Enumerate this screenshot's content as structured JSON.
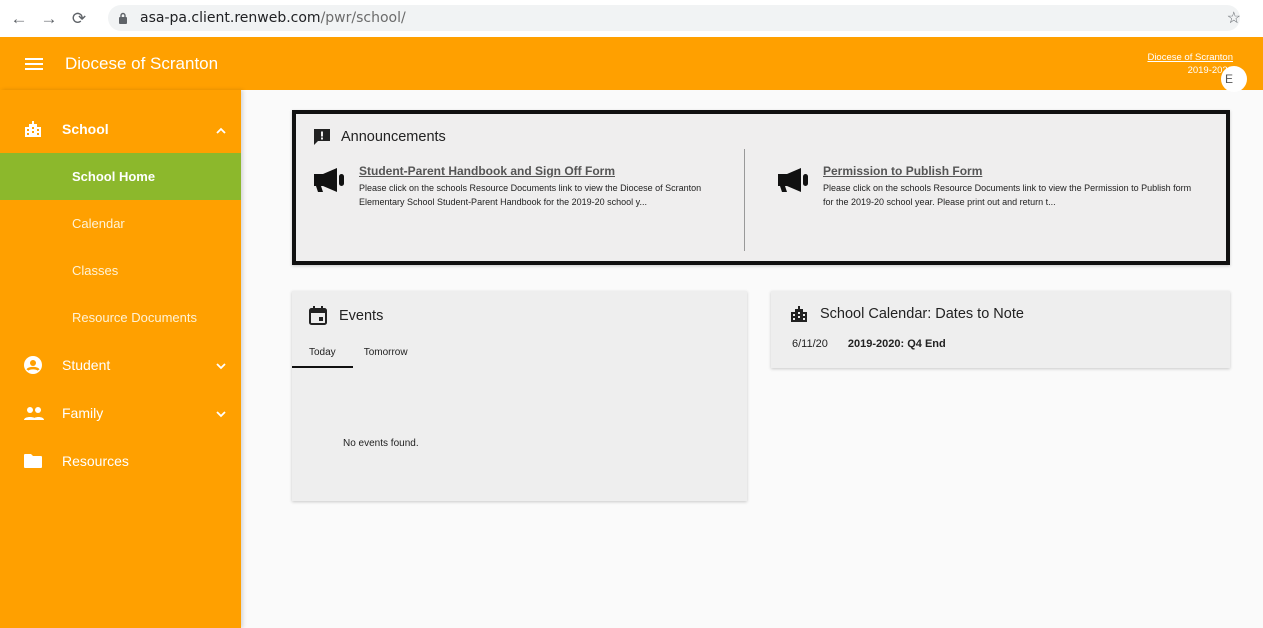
{
  "browser": {
    "url_host": "asa-pa.client.renweb.com",
    "url_path": "/pwr/school/"
  },
  "header": {
    "title": "Diocese of Scranton",
    "org_link": "Diocese of Scranton",
    "school_year": "2019-2020",
    "avatar_letter": "E"
  },
  "sidebar": {
    "school": {
      "label": "School"
    },
    "school_items": [
      {
        "label": "School Home",
        "active": true
      },
      {
        "label": "Calendar"
      },
      {
        "label": "Classes"
      },
      {
        "label": "Resource Documents"
      }
    ],
    "student": {
      "label": "Student"
    },
    "family": {
      "label": "Family"
    },
    "resources": {
      "label": "Resources"
    }
  },
  "announcements": {
    "heading": "Announcements",
    "items": [
      {
        "title": "Student-Parent Handbook and Sign Off Form",
        "body": "Please click on the schools Resource Documents link to view the Diocese of Scranton Elementary School Student-Parent Handbook for the 2019-20 school y..."
      },
      {
        "title": "Permission to Publish Form",
        "body": "Please click on the schools Resource Documents link to view the Permission to Publish form for the 2019-20 school year. Please print out and return t..."
      }
    ]
  },
  "events": {
    "heading": "Events",
    "tabs": [
      "Today",
      "Tomorrow"
    ],
    "empty_text": "No events found."
  },
  "calendar": {
    "heading": "School Calendar: Dates to Note",
    "entries": [
      {
        "date": "6/11/20",
        "event": "2019-2020: Q4 End"
      }
    ]
  },
  "colors": {
    "brand_orange": "#ffa000",
    "active_green": "#8cb82c"
  }
}
